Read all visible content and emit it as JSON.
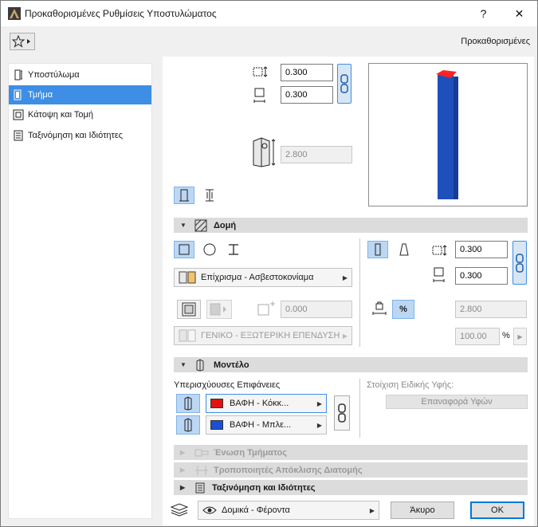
{
  "window": {
    "title": "Προκαθορισμένες Ρυθμίσεις Υποστυλώματος",
    "help_label": "?",
    "close_label": "✕"
  },
  "toolbar": {
    "favorites_icon": "star-icon",
    "preset_label": "Προκαθορισμένες"
  },
  "sidebar": {
    "items": [
      {
        "label": "Υποστύλωμα",
        "icon": "column-icon",
        "active": false
      },
      {
        "label": "Τμήμα",
        "icon": "segment-icon",
        "active": true
      },
      {
        "label": "Κάτοψη και Τομή",
        "icon": "floorplan-icon",
        "active": false
      },
      {
        "label": "Ταξινόμηση και Ιδιότητες",
        "icon": "properties-icon",
        "active": false
      }
    ]
  },
  "top": {
    "width_value": "0.300",
    "depth_value": "0.300",
    "height_value": "2.800"
  },
  "structure": {
    "title": "Δομή",
    "material_label": "Επίχρισμα - Ασβεστοκονίαμα",
    "veneer_value": "0.000",
    "veneer_type_label": "ΓΕΝΙΚΟ - ΕΞΩΤΕΡΙΚΗ ΕΠΕΝΔΥΣΗ",
    "width_value": "0.300",
    "depth_value": "0.300",
    "height_value": "2.800",
    "percent_value": "100.00",
    "percent_sign": "%",
    "percent_toggle_label": "%"
  },
  "model": {
    "title": "Μοντέλο",
    "override_label": "Υπερισχύουσες Επιφάνειες",
    "surface1_label": "ΒΑΦΗ - Κόκκ...",
    "surface1_color": "#e21212",
    "surface2_label": "ΒΑΦΗ - Μπλε...",
    "surface2_color": "#1a4fd6",
    "texture_label": "Στοίχιση Ειδικής Υφής:",
    "reset_texture_label": "Επαναφορά Υφών"
  },
  "collapsed_sections": [
    {
      "label": "Ένωση Τμήματος",
      "enabled": false
    },
    {
      "label": "Τροποποιητές Απόκλισης Διατομής",
      "enabled": false
    },
    {
      "label": "Ταξινόμηση και Ιδιότητες",
      "enabled": true
    }
  ],
  "footer": {
    "layer_label": "Δομικά - Φέροντα",
    "cancel_label": "Άκυρο",
    "ok_label": "OK"
  }
}
